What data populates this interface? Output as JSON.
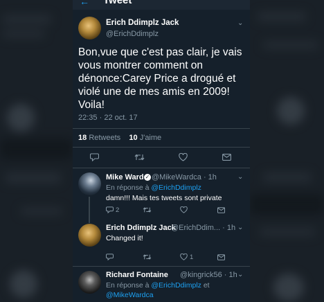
{
  "header": {
    "title": "Tweet"
  },
  "main_tweet": {
    "author_name": "Erich Ddimplz Jack",
    "author_handle": "@ErichDdimplz",
    "text": "Bon,vue que c'est pas clair, je vais vous montrer comment on dénonce:Carey Price a drogué et violé une de mes amis en 2009! Voila!",
    "time": "22:35",
    "date": "22 oct. 17",
    "retweets_count": "18",
    "retweets_label": "Retweets",
    "likes_count": "10",
    "likes_label": "J'aime"
  },
  "replies": [
    {
      "author_name": "Mike Ward",
      "author_handle": "@MikeWardca",
      "age": "1h",
      "reply_prefix": "En réponse à",
      "reply_to": "@ErichDdimplz",
      "text": "damn!!! Mais tes tweets sont private",
      "reply_count": "2",
      "like_count": ""
    },
    {
      "author_name": "Erich Ddimplz Jack",
      "author_handle": "@ErichDdim...",
      "age": "1h",
      "text": "Changed it!",
      "reply_count": "",
      "like_count": "1"
    },
    {
      "author_name": "Richard Fontaine",
      "author_handle": "@kingrick56",
      "age": "1h",
      "reply_prefix": "En réponse à",
      "reply_to": "@ErichDdimplz",
      "reply_to_joiner": "et",
      "reply_to_2": "@MikeWardca"
    }
  ],
  "icons": {
    "reply": "reply-icon",
    "retweet": "retweet-icon",
    "like": "heart-icon",
    "message": "envelope-icon",
    "more": "chevron-down-icon",
    "verified": "verified-badge-icon"
  },
  "colors": {
    "background": "#15202b",
    "accent": "#1da1f2",
    "muted": "#8899a6",
    "divider": "#38444d"
  }
}
